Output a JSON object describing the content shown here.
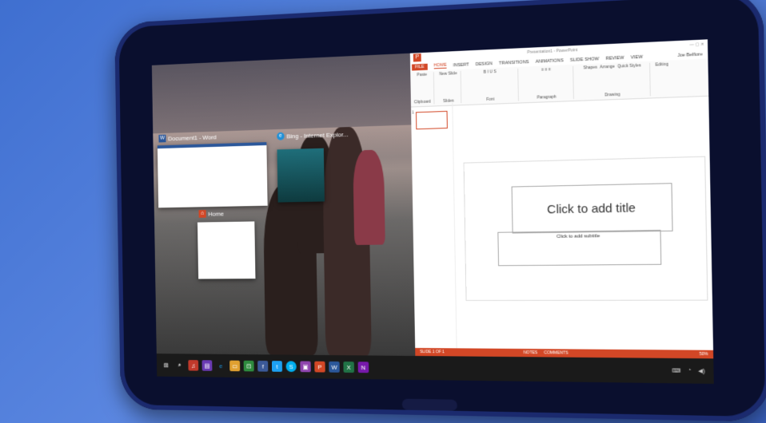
{
  "desktop": {
    "word_thumb": {
      "title": "Document1 - Word"
    },
    "ie_thumb": {
      "title": "Bing - Internet Explor..."
    },
    "explorer_thumb": {
      "title": "Home"
    }
  },
  "powerpoint": {
    "window_title": "Presentation1 - PowerPoint",
    "user_name": "Joe Belfiore",
    "tabs": [
      "FILE",
      "HOME",
      "INSERT",
      "DESIGN",
      "TRANSITIONS",
      "ANIMATIONS",
      "SLIDE SHOW",
      "REVIEW",
      "VIEW"
    ],
    "ribbon_groups": [
      "Clipboard",
      "Slides",
      "Font",
      "Paragraph",
      "Drawing",
      "Editing"
    ],
    "ribbon_buttons": {
      "paste": "Paste",
      "new_slide": "New Slide",
      "shapes": "Shapes",
      "arrange": "Arrange",
      "quick_styles": "Quick Styles",
      "editing": "Editing"
    },
    "slide_number": "1",
    "title_placeholder": "Click to add title",
    "subtitle_placeholder": "Click to add subtitle",
    "status": {
      "slide_info": "SLIDE 1 OF 1",
      "notes": "NOTES",
      "comments": "COMMENTS",
      "zoom": "50%"
    }
  },
  "taskbar": {
    "icons": [
      "windows-start",
      "search",
      "music",
      "app",
      "ie",
      "file-explorer",
      "store",
      "facebook",
      "twitter",
      "skype",
      "app2",
      "powerpoint",
      "word",
      "excel",
      "onenote"
    ]
  },
  "colors": {
    "ppt_accent": "#d24726",
    "word_accent": "#2b579a",
    "taskbar": "#1a1a1a"
  }
}
